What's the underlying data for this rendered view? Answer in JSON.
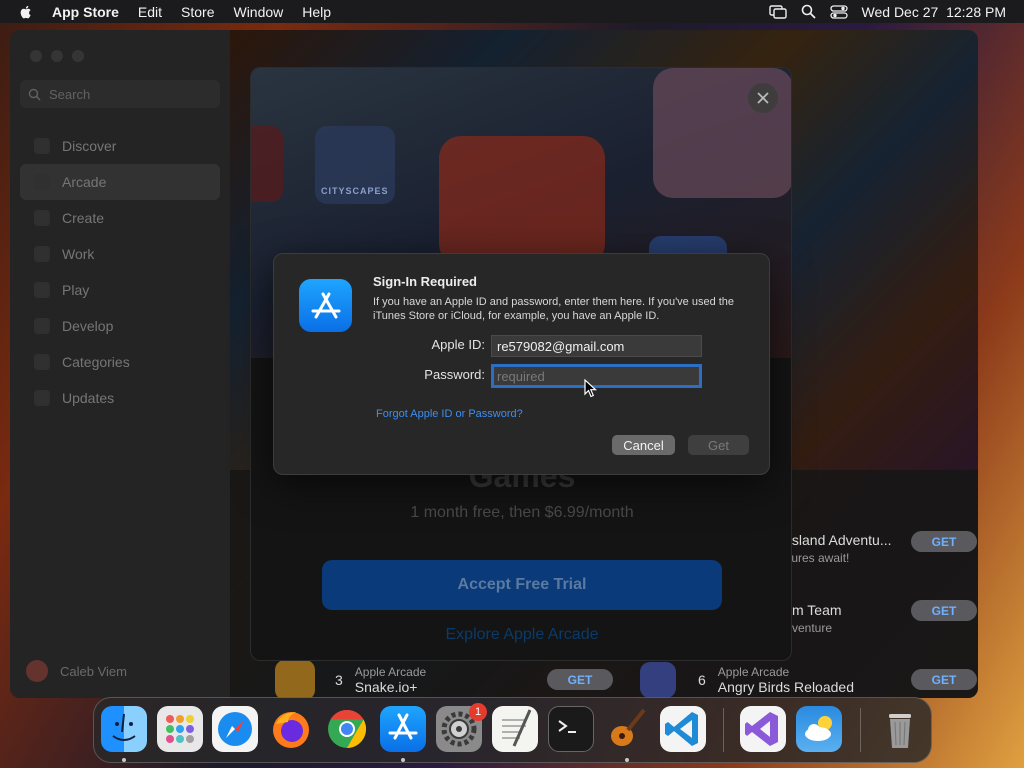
{
  "menubar": {
    "app_name": "App Store",
    "menus": [
      "Edit",
      "Store",
      "Window",
      "Help"
    ],
    "datetime": "Wed Dec 27  12:28 PM"
  },
  "sidebar": {
    "search_placeholder": "Search",
    "items": [
      "Discover",
      "Arcade",
      "Create",
      "Work",
      "Play",
      "Develop",
      "Categories",
      "Updates"
    ],
    "active": "Arcade",
    "user_name": "Caleb Viem"
  },
  "sheet": {
    "hero_label": "CITYSCAPES",
    "title": "Games",
    "trial_text": "1 month free, then $6.99/month",
    "accept_label": "Accept Free Trial",
    "explore_label": "Explore Apple Arcade"
  },
  "background_list": [
    {
      "rank": "3",
      "name": "Snake.io+",
      "category": "Apple Arcade",
      "get": "GET"
    },
    {
      "rank": "6",
      "name": "Angry Birds Reloaded",
      "category": "Apple Arcade",
      "get": "GET"
    },
    {
      "rank": "",
      "name": "Island Adventu...",
      "subtitle": "tures await!",
      "get": "GET"
    },
    {
      "rank": "",
      "name": "m Team",
      "subtitle": "venture",
      "get": "GET"
    }
  ],
  "dialog": {
    "title": "Sign-In Required",
    "message": "If you have an Apple ID and password, enter them here. If you've used the iTunes Store or iCloud, for example, you have an Apple ID.",
    "apple_id_label": "Apple ID:",
    "apple_id_value": "re579082@gmail.com",
    "password_label": "Password:",
    "password_placeholder": "required",
    "forgot_link": "Forgot Apple ID or Password?",
    "cancel_label": "Cancel",
    "get_label": "Get"
  },
  "dock": {
    "system_settings_badge": "1"
  },
  "colors": {
    "accent": "#2b6fc4",
    "link": "#3d8ef0",
    "badge": "#e33b2e"
  }
}
